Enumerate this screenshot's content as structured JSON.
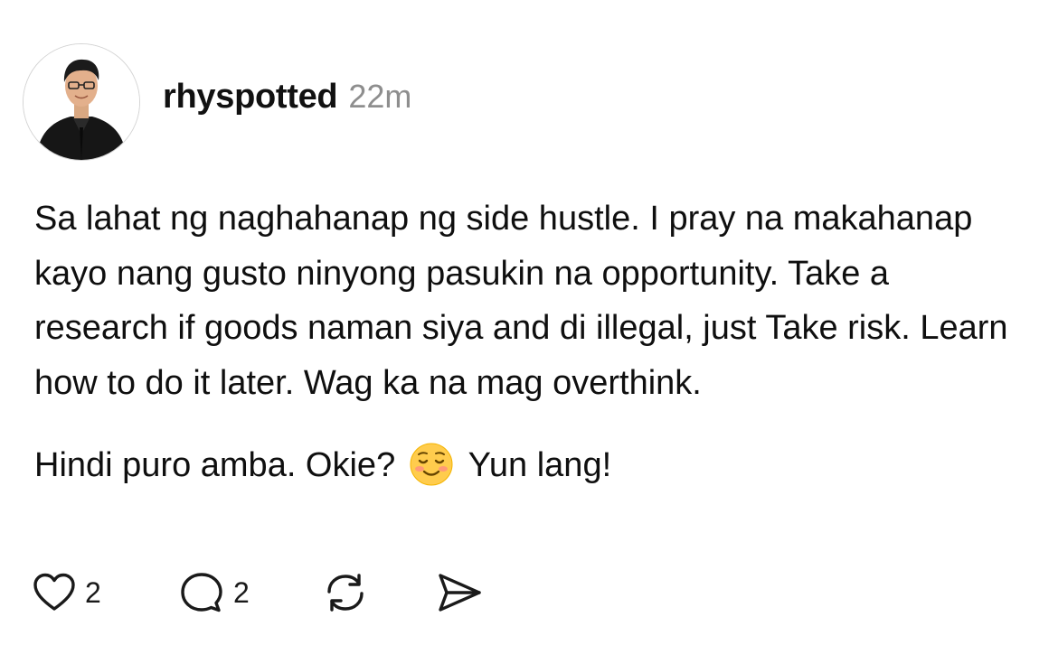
{
  "post": {
    "author": {
      "username": "rhyspotted",
      "avatar_icon": "profile-photo"
    },
    "timestamp": "22m",
    "paragraphs": [
      "Sa lahat ng naghahanap ng side hustle. I pray na makahanap kayo nang gusto ninyong pasukin na opportunity. Take a research if goods naman siya and di illegal, just Take risk. Learn how to do it later. Wag ka na mag overthink.",
      {
        "before_emoji": "Hindi puro amba. Okie?",
        "emoji": "smiling-face-emoji",
        "after_emoji": "Yun lang!"
      }
    ],
    "actions": {
      "like": {
        "icon": "heart-icon",
        "count": "2"
      },
      "reply": {
        "icon": "comment-icon",
        "count": "2"
      },
      "repost": {
        "icon": "repost-icon"
      },
      "share": {
        "icon": "send-icon"
      }
    },
    "colors": {
      "text": "#0f0f0f",
      "muted": "#8e8e8e",
      "icon": "#1a1a1a",
      "emoji_face": "#ffcc4d"
    }
  }
}
